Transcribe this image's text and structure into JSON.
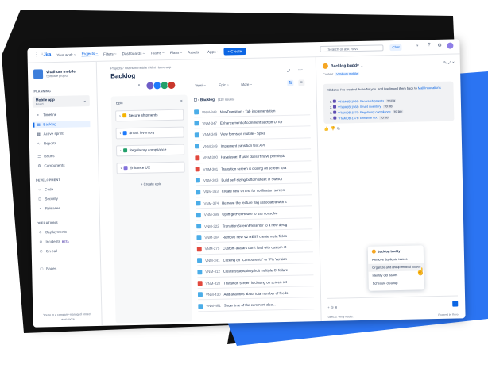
{
  "colors": {
    "accent": "#0c66e4",
    "bg_black": "#111111",
    "bg_blue": "#2b74f2"
  },
  "topnav": {
    "logo": "Jira",
    "items": [
      "Your work ~",
      "Projects ~",
      "Filters ~",
      "Dashboards ~",
      "Teams ~",
      "Plans ~",
      "Assets ~",
      "Apps ~"
    ],
    "create": "+ Create",
    "search_placeholder": "Search or ask Rovo",
    "chat": "Chat"
  },
  "sidebar": {
    "project_name": "Vitalhum mobile",
    "project_type": "Software project",
    "planning_label": "PLANNING",
    "board_name": "Mobile app",
    "board_type": "Board",
    "planning_items": [
      "Timeline",
      "Backlog",
      "Active sprint",
      "Reports"
    ],
    "other_items": [
      "Issues",
      "Components"
    ],
    "development_label": "DEVELOPMENT",
    "dev_items": [
      "Code",
      "Security",
      "Releases"
    ],
    "operations_label": "OPERATIONS",
    "ops_items": [
      "Deployments",
      "On-call"
    ],
    "incidents": "Incidents",
    "beta": "BETA",
    "pages": "Pages",
    "footer_line1": "You're in a company-managed project",
    "footer_line2": "Learn more"
  },
  "main": {
    "breadcrumb": "Projects / Vitalhum mobile / Mini Home app",
    "title": "Backlog",
    "filters": [
      "Versi ~",
      "Epic ~",
      "More ~"
    ],
    "epic_panel": {
      "header": "Epic",
      "epics": [
        {
          "name": "Secure shipments",
          "color": "#f5b300"
        },
        {
          "name": "Smart inventory",
          "color": "#1d7afc"
        },
        {
          "name": "Regulatory compliance",
          "color": "#22a06b"
        },
        {
          "name": "Enhance UX",
          "color": "#8270db"
        }
      ],
      "create": "+ Create epic"
    },
    "backlog": {
      "header": "Backlog",
      "count": "(118 issues)",
      "rows": [
        {
          "key": "VNM-343",
          "summary": "NewTransition - Tab implementation",
          "type": "story"
        },
        {
          "key": "VNM-347",
          "summary": "Enhancement of comment section UI for",
          "type": "story"
        },
        {
          "key": "VNM-349",
          "summary": "View forms on mobile - Spike",
          "type": "story"
        },
        {
          "key": "VNM-349",
          "summary": "Implement transition text API",
          "type": "task"
        },
        {
          "key": "VNM-300",
          "summary": "Haveissue: If user doesn't have permissio",
          "type": "bug"
        },
        {
          "key": "VNM-301",
          "summary": "Transition screen is closing on screen rota",
          "type": "bug"
        },
        {
          "key": "VNM-303",
          "summary": "Build self-sizing bottom sheet in SwiftUI",
          "type": "story"
        },
        {
          "key": "VNM-363",
          "summary": "Create new UI text for notification screen",
          "type": "story"
        },
        {
          "key": "VNM-374",
          "summary": "Remove the feature flag associated with s",
          "type": "story"
        },
        {
          "key": "VNM-399",
          "summary": "Uplift getFlexHouse to use consolve",
          "type": "story"
        },
        {
          "key": "VNM-322",
          "summary": "TransitionScreenPresenter to a new desig",
          "type": "story"
        },
        {
          "key": "VNM-384",
          "summary": "Remove new V2 REST create meta fields",
          "type": "story"
        },
        {
          "key": "VNM-275",
          "summary": "Custom avatars don't load with custom st",
          "type": "bug"
        },
        {
          "key": "VNM-341",
          "summary": "Clicking on \"Components\" or \"Fix Version",
          "type": "story"
        },
        {
          "key": "VNM-412",
          "summary": "CreateIssueActivity/fruit multiple CI failure",
          "type": "story"
        },
        {
          "key": "VNM-420",
          "summary": "Transition screen is closing on screen rot",
          "type": "bug"
        },
        {
          "key": "VNM-430",
          "summary": "Add analytics about total number of feeds",
          "type": "story"
        },
        {
          "key": "VNM-481",
          "summary": "Show time of the comment also...",
          "type": "story"
        }
      ]
    }
  },
  "panel": {
    "title": "Backlog buddy",
    "context_label": "Context",
    "context_tag": "Vitalhum mobile",
    "message": "All done! I've created those for you, and I've linked them back to",
    "message_link": "Mall Innovations",
    "items": [
      {
        "key": "VTAMOB-1566",
        "name": "Secure shipments",
        "status": "TO DO"
      },
      {
        "key": "VTAMOB-1568",
        "name": "Smart inventory",
        "status": "TO DO"
      },
      {
        "key": "VTAMOB-1570",
        "name": "Regulatory compliance",
        "status": "TO DO"
      },
      {
        "key": "VTAMOB-1576",
        "name": "Enhance UX",
        "status": "TO DO"
      }
    ],
    "popup": {
      "title": "Backlog buddy",
      "options": [
        "Remove duplicate issues",
        "Organize and group related issues",
        "Identify old issues",
        "Schedule cleanup"
      ]
    },
    "footer_left": "Uses AI. Verify results.",
    "footer_right": "Powered by Rovo"
  }
}
